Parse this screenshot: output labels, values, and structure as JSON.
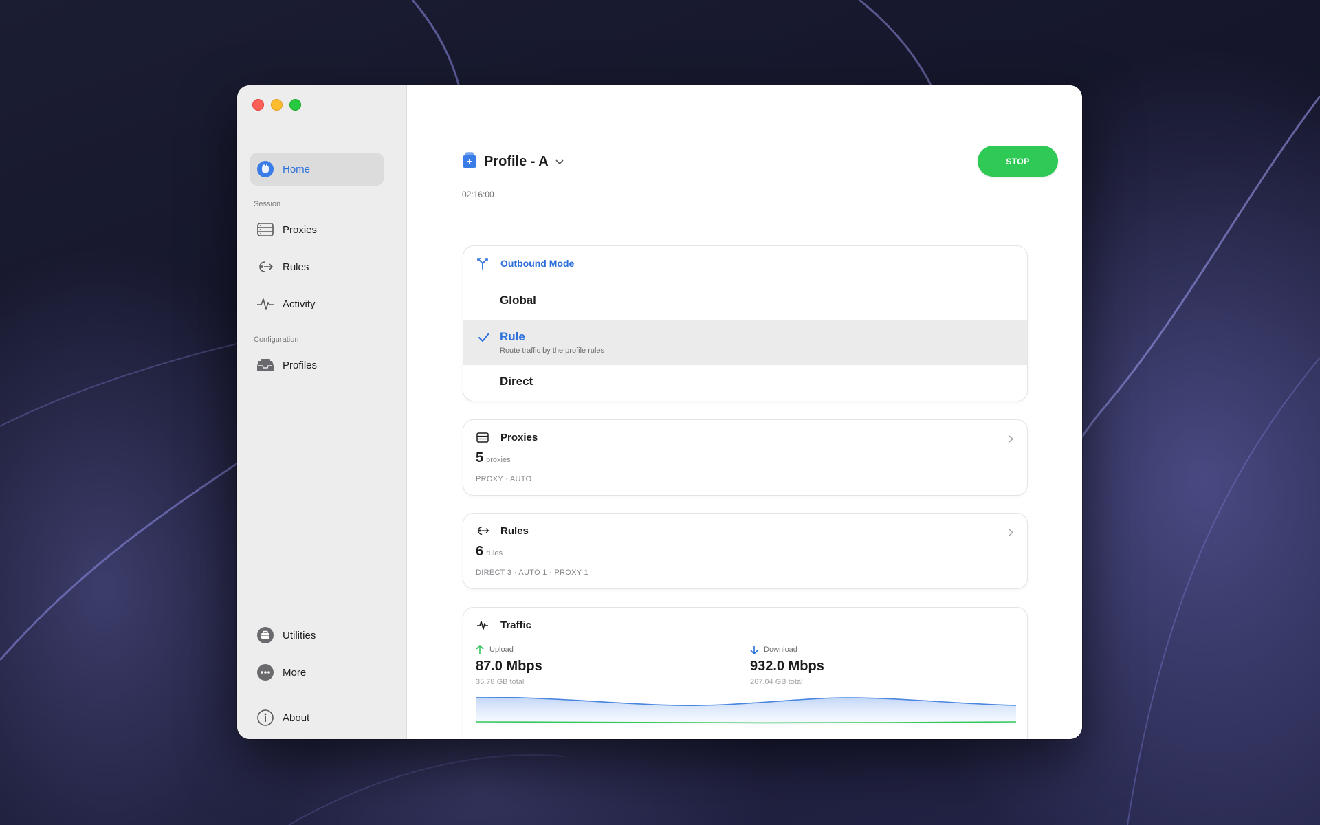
{
  "window": {
    "controls": [
      "close",
      "minimize",
      "zoom"
    ]
  },
  "sidebar": {
    "home": {
      "label": "Home",
      "icon": "home-app-icon"
    },
    "session_label": "Session",
    "session_items": [
      {
        "label": "Proxies",
        "icon": "server-rack-icon"
      },
      {
        "label": "Rules",
        "icon": "route-arrow-icon"
      },
      {
        "label": "Activity",
        "icon": "pulse-icon"
      }
    ],
    "configuration_label": "Configuration",
    "configuration_items": [
      {
        "label": "Profiles",
        "icon": "tray-icon"
      }
    ],
    "bottom_items": [
      {
        "label": "Utilities",
        "icon": "toolbox-icon"
      },
      {
        "label": "More",
        "icon": "ellipsis-circle-icon"
      }
    ],
    "about": {
      "label": "About",
      "icon": "info-circle-icon"
    }
  },
  "header": {
    "profile_name": "Profile - A",
    "elapsed": "02:16:00",
    "stop_label": "STOP"
  },
  "outbound": {
    "title": "Outbound Mode",
    "options": [
      {
        "label": "Global",
        "selected": false
      },
      {
        "label": "Rule",
        "selected": true,
        "description": "Route traffic by the profile rules"
      },
      {
        "label": "Direct",
        "selected": false
      }
    ]
  },
  "proxies_card": {
    "title": "Proxies",
    "count": "5",
    "unit": "proxies",
    "summary": "PROXY · AUTO"
  },
  "rules_card": {
    "title": "Rules",
    "count": "6",
    "unit": "rules",
    "summary": "DIRECT 3 · AUTO 1 · PROXY 1"
  },
  "traffic_card": {
    "title": "Traffic",
    "upload": {
      "label": "Upload",
      "value": "87.0 Mbps",
      "total": "35.78 GB total"
    },
    "download": {
      "label": "Download",
      "value": "932.0 Mbps",
      "total": "267.04 GB total"
    }
  },
  "colors": {
    "accent": "#2a6fdb",
    "stop_button": "#2fc956",
    "upload_line": "#34c759",
    "download_line": "#4a86e0"
  }
}
